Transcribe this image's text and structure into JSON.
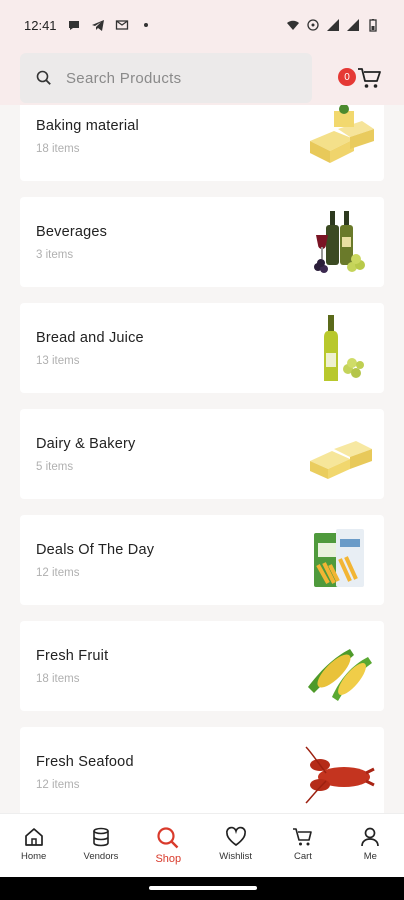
{
  "status_bar": {
    "time": "12:41"
  },
  "search": {
    "placeholder": "Search Products"
  },
  "cart": {
    "count": "0"
  },
  "categories": [
    {
      "name": "Baking material",
      "count": "18 items",
      "icon": "cheese-image"
    },
    {
      "name": "Beverages",
      "count": "3 items",
      "icon": "wine-image"
    },
    {
      "name": "Bread and Juice",
      "count": "13 items",
      "icon": "wine-bottle-image"
    },
    {
      "name": "Dairy & Bakery",
      "count": "5 items",
      "icon": "cheese-image"
    },
    {
      "name": "Deals Of The Day",
      "count": "12 items",
      "icon": "snack-bags-image"
    },
    {
      "name": "Fresh Fruit",
      "count": "18 items",
      "icon": "corn-image"
    },
    {
      "name": "Fresh Seafood",
      "count": "12 items",
      "icon": "lobster-image"
    }
  ],
  "nav": [
    {
      "label": "Home",
      "icon": "home-icon"
    },
    {
      "label": "Vendors",
      "icon": "vendors-icon"
    },
    {
      "label": "Shop",
      "icon": "search-icon"
    },
    {
      "label": "Wishlist",
      "icon": "heart-icon"
    },
    {
      "label": "Cart",
      "icon": "cart-icon"
    },
    {
      "label": "Me",
      "icon": "user-icon"
    }
  ],
  "colors": {
    "accent": "#d93a2b",
    "header_bg": "#f8ecec",
    "badge": "#e53935"
  }
}
